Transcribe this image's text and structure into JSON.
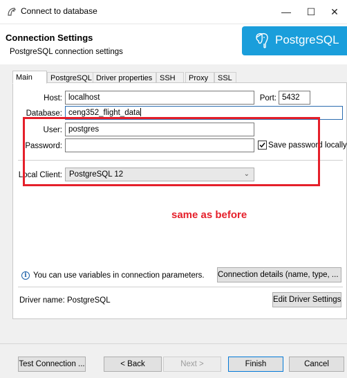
{
  "window": {
    "title": "Connect to database",
    "controls": {
      "minimize": "—",
      "maximize": "☐",
      "close": "✕"
    }
  },
  "header": {
    "title": "Connection Settings",
    "subtitle": "PostgreSQL connection settings",
    "logo_text": "PostgreSQL",
    "logo_color": "#1a9edb"
  },
  "tabs": [
    {
      "label": "Main",
      "active": true
    },
    {
      "label": "PostgreSQL",
      "active": false
    },
    {
      "label": "Driver properties",
      "active": false
    },
    {
      "label": "SSH",
      "active": false
    },
    {
      "label": "Proxy",
      "active": false
    },
    {
      "label": "SSL",
      "active": false
    }
  ],
  "form": {
    "host_label": "Host:",
    "host_value": "localhost",
    "port_label": "Port:",
    "port_value": "5432",
    "database_label": "Database:",
    "database_value": "ceng352_flight_data",
    "user_label": "User:",
    "user_value": "postgres",
    "password_label": "Password:",
    "password_value": "",
    "save_password_label": "Save password locally",
    "save_password_checked": true,
    "local_client_label": "Local Client:",
    "local_client_value": "PostgreSQL 12"
  },
  "annotation": {
    "text": "same as before",
    "color": "#e51f2a"
  },
  "info": {
    "variables_hint": "You can use variables in connection parameters.",
    "connection_details_button": "Connection details (name, type, ... )"
  },
  "driver": {
    "name_label": "Driver name:",
    "name_value": "PostgreSQL",
    "edit_button": "Edit Driver Settings"
  },
  "footer": {
    "test_connection": "Test Connection ...",
    "back": "< Back",
    "next": "Next >",
    "finish": "Finish",
    "cancel": "Cancel"
  }
}
